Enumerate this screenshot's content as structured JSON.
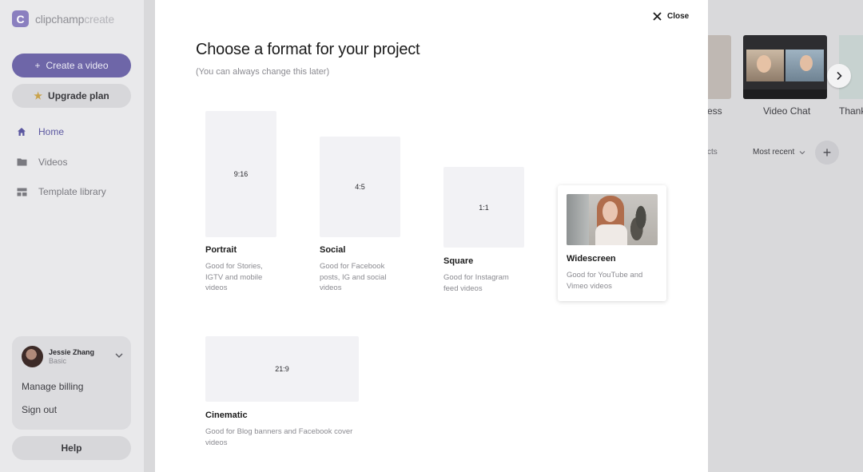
{
  "app": {
    "logo_letter": "C",
    "logo_name_bold": "clipchamp",
    "logo_name_light": "create",
    "create_label": "Create a video",
    "upgrade_label": "Upgrade plan",
    "help_label": "Help",
    "accent_color": "#6e66a8"
  },
  "sidebar": {
    "items": [
      {
        "label": "Home",
        "icon": "home-icon",
        "active": true
      },
      {
        "label": "Videos",
        "icon": "folder-icon",
        "active": false
      },
      {
        "label": "Template library",
        "icon": "template-icon",
        "active": false
      }
    ]
  },
  "account": {
    "name": "Jessie Zhang",
    "plan": "Basic",
    "manage_billing": "Manage billing",
    "sign_out": "Sign out"
  },
  "background": {
    "template_left_label": "ess",
    "template_video_label": "Video Chat",
    "template_right_label": "Thank",
    "projects_label": "cts",
    "sort_label": "Most recent"
  },
  "modal": {
    "close_label": "Close",
    "title": "Choose a format for your project",
    "subtitle": "(You can always change this later)",
    "formats": [
      {
        "ratio": "9:16",
        "name": "Portrait",
        "desc": "Good for Stories, IGTV and mobile videos"
      },
      {
        "ratio": "4:5",
        "name": "Social",
        "desc": "Good for Facebook posts, IG and social videos"
      },
      {
        "ratio": "1:1",
        "name": "Square",
        "desc": "Good for Instagram feed videos"
      },
      {
        "ratio": "",
        "name": "Widescreen",
        "desc": "Good for YouTube and Vimeo videos"
      },
      {
        "ratio": "21:9",
        "name": "Cinematic",
        "desc": "Good for Blog banners and Facebook cover videos"
      }
    ]
  }
}
